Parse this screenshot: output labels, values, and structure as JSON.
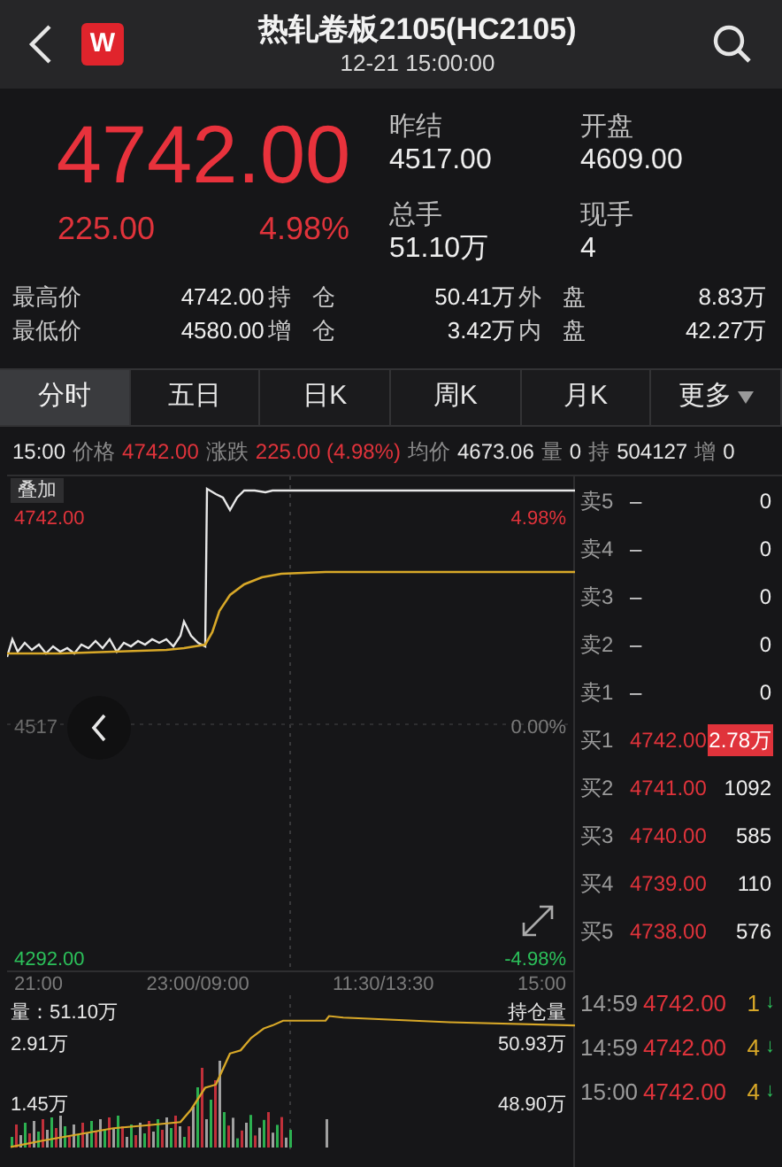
{
  "header": {
    "logo_text": "W",
    "title": "热轧卷板2105(HC2105)",
    "subtitle": "12-21 15:00:00"
  },
  "quote": {
    "price": "4742.00",
    "change": "225.00",
    "change_pct": "4.98%",
    "fields": [
      {
        "label": "昨结",
        "value": "4517.00"
      },
      {
        "label": "开盘",
        "value": "4609.00"
      },
      {
        "label": "总手",
        "value": "51.10万"
      },
      {
        "label": "现手",
        "value": "4"
      }
    ]
  },
  "stats": [
    [
      {
        "label": "最高价",
        "value": "4742.00"
      },
      {
        "label": "持仓",
        "value": "50.41万"
      },
      {
        "label": "外盘",
        "value": "8.83万"
      }
    ],
    [
      {
        "label": "最低价",
        "value": "4580.00"
      },
      {
        "label": "增仓",
        "value": "3.42万"
      },
      {
        "label": "内盘",
        "value": "42.27万"
      }
    ]
  ],
  "tabs": [
    {
      "label": "分时",
      "selected": true
    },
    {
      "label": "五日",
      "selected": false
    },
    {
      "label": "日K",
      "selected": false
    },
    {
      "label": "周K",
      "selected": false
    },
    {
      "label": "月K",
      "selected": false
    },
    {
      "label": "更多",
      "selected": false,
      "dropdown": true
    }
  ],
  "info_bar": [
    {
      "label": "15:00",
      "kind": "value"
    },
    {
      "label": "价格",
      "kind": "label"
    },
    {
      "label": "4742.00",
      "kind": "price"
    },
    {
      "label": "涨跌",
      "kind": "label"
    },
    {
      "label": "225.00 (4.98%)",
      "kind": "price"
    },
    {
      "label": "均价",
      "kind": "label"
    },
    {
      "label": "4673.06",
      "kind": "value"
    },
    {
      "label": "量",
      "kind": "label"
    },
    {
      "label": "0",
      "kind": "value"
    },
    {
      "label": "持",
      "kind": "label"
    },
    {
      "label": "504127",
      "kind": "value"
    },
    {
      "label": "增",
      "kind": "label"
    },
    {
      "label": "0",
      "kind": "value"
    }
  ],
  "price_chart": {
    "overlay_button": "叠加",
    "high": "4742.00",
    "high_pct": "4.98%",
    "mid": "4517",
    "mid_pct": "0.00%",
    "low": "4292.00",
    "low_pct": "-4.98%"
  },
  "time_axis": [
    "21:00",
    "23:00/09:00",
    "11:30/13:30",
    "15:00"
  ],
  "volume_chart": {
    "volume_label": "量：51.10万",
    "oi_label": "持仓量",
    "vol_high": "2.91万",
    "oi_high": "50.93万",
    "vol_mid": "1.45万",
    "oi_mid": "48.90万"
  },
  "order_book": [
    {
      "label": "卖5",
      "price": "–",
      "volume": "0",
      "kind": "sell",
      "highlighted": false
    },
    {
      "label": "卖4",
      "price": "–",
      "volume": "0",
      "kind": "sell",
      "highlighted": false
    },
    {
      "label": "卖3",
      "price": "–",
      "volume": "0",
      "kind": "sell",
      "highlighted": false
    },
    {
      "label": "卖2",
      "price": "–",
      "volume": "0",
      "kind": "sell",
      "highlighted": false
    },
    {
      "label": "卖1",
      "price": "–",
      "volume": "0",
      "kind": "sell",
      "highlighted": false
    },
    {
      "label": "买1",
      "price": "4742.00",
      "volume": "2.78万",
      "kind": "buy",
      "highlighted": true
    },
    {
      "label": "买2",
      "price": "4741.00",
      "volume": "1092",
      "kind": "buy",
      "highlighted": false
    },
    {
      "label": "买3",
      "price": "4740.00",
      "volume": "585",
      "kind": "buy",
      "highlighted": false
    },
    {
      "label": "买4",
      "price": "4739.00",
      "volume": "110",
      "kind": "buy",
      "highlighted": false
    },
    {
      "label": "买5",
      "price": "4738.00",
      "volume": "576",
      "kind": "buy",
      "highlighted": false
    }
  ],
  "trades": [
    {
      "time": "14:59",
      "price": "4742.00",
      "volume": "1",
      "arrow": "↓"
    },
    {
      "time": "14:59",
      "price": "4742.00",
      "volume": "4",
      "arrow": "↓"
    },
    {
      "time": "15:00",
      "price": "4742.00",
      "volume": "4",
      "arrow": "↓"
    }
  ]
}
